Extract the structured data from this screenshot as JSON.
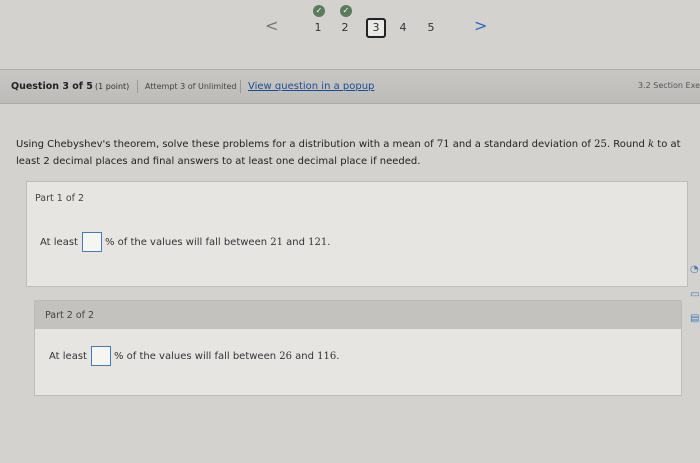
{
  "nav": {
    "prev_arrow": "<",
    "next_arrow": ">",
    "items": [
      {
        "label": "1",
        "completed": true
      },
      {
        "label": "2",
        "completed": true
      },
      {
        "label": "3",
        "completed": false,
        "current": true
      },
      {
        "label": "4",
        "completed": false
      },
      {
        "label": "5",
        "completed": false
      }
    ],
    "check_glyph": "✓"
  },
  "question_bar": {
    "title": "Question 3 of 5",
    "points": "(1 point)",
    "attempt": "Attempt 3 of Unlimited",
    "popup_link": "View question in a popup",
    "section": "3.2 Section Exe"
  },
  "prompt": {
    "text_a": "Using Chebyshev's theorem, solve these problems for a distribution with a mean of ",
    "mean": "71",
    "text_b": " and a standard deviation of ",
    "sd": "25",
    "text_c": ". Round ",
    "kvar": "k",
    "text_d": " to at least 2 decimal places and final answers to at least one decimal place if needed."
  },
  "parts": [
    {
      "label": "Part 1 of 2",
      "lead": "At least",
      "mid": "% of the values will fall between ",
      "low": "21",
      "and": " and ",
      "high": "121",
      "end": "."
    },
    {
      "label": "Part 2 of 2",
      "lead": "At least",
      "mid": "% of the values will fall between ",
      "low": "26",
      "and": " and ",
      "high": "116",
      "end": "."
    }
  ],
  "colors": {
    "accent": "#1a4d94",
    "answer_border": "#4a79b8",
    "completed_check": "#5c7a5e"
  }
}
